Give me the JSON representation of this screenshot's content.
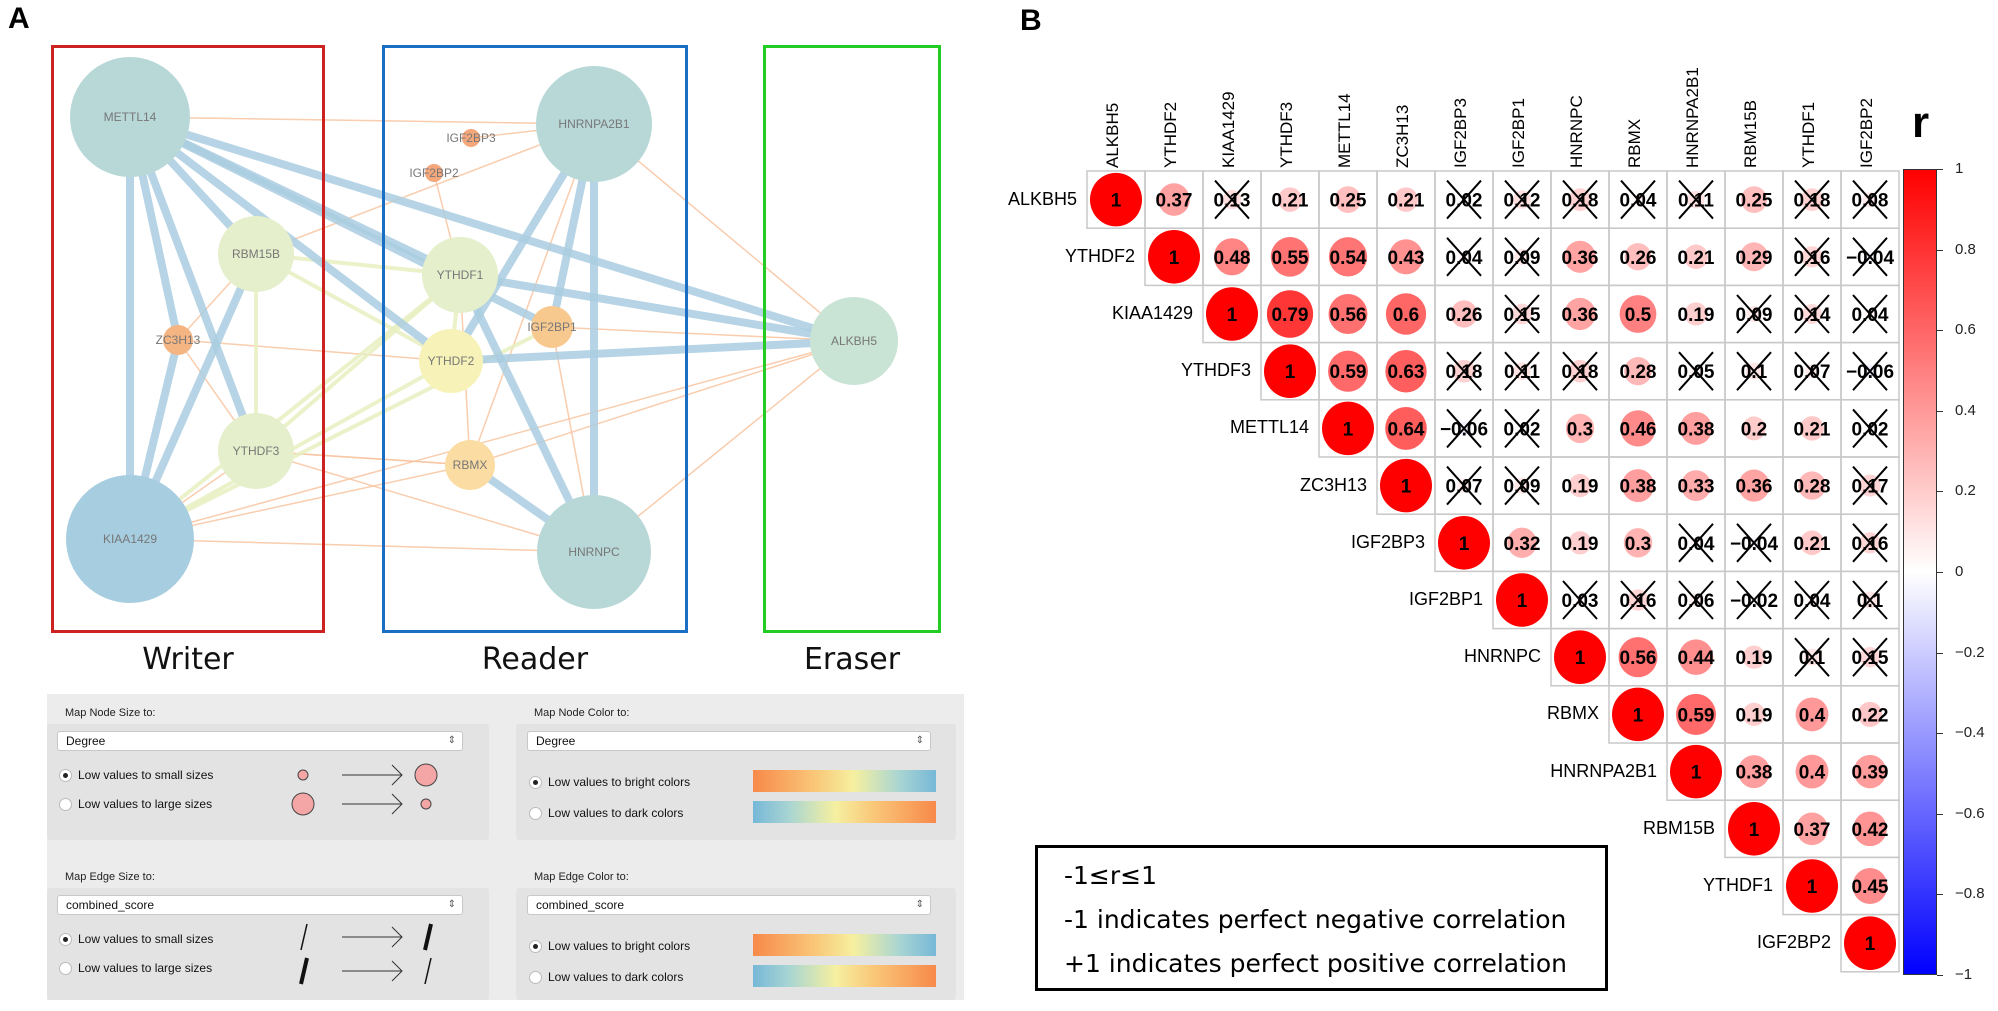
{
  "panel_a": {
    "letter": "A",
    "groups": [
      {
        "label": "Writer",
        "color": "#cc2222"
      },
      {
        "label": "Reader",
        "color": "#1a6fc4"
      },
      {
        "label": "Eraser",
        "color": "#22cc22"
      }
    ],
    "nodes": [
      {
        "name": "METTL14",
        "group": "Writer",
        "color": "#b8d8d8"
      },
      {
        "name": "RBM15B",
        "group": "Writer",
        "color": "#e6efcc"
      },
      {
        "name": "ZC3H13",
        "group": "Writer",
        "color": "#f5b583"
      },
      {
        "name": "YTHDF3",
        "group": "Writer",
        "color": "#e6efcc"
      },
      {
        "name": "KIAA1429",
        "group": "Writer",
        "color": "#a7cde0"
      },
      {
        "name": "HNRNPA2B1",
        "group": "Reader",
        "color": "#b8d8d8"
      },
      {
        "name": "IGF2BP3",
        "group": "Reader",
        "color": "#f3a77b"
      },
      {
        "name": "IGF2BP2",
        "group": "Reader",
        "color": "#f3a77b"
      },
      {
        "name": "YTHDF1",
        "group": "Reader",
        "color": "#e6efcc"
      },
      {
        "name": "IGF2BP1",
        "group": "Reader",
        "color": "#f8c98f"
      },
      {
        "name": "YTHDF2",
        "group": "Reader",
        "color": "#f7f3b8"
      },
      {
        "name": "RBMX",
        "group": "Reader",
        "color": "#fbdca3"
      },
      {
        "name": "HNRNPC",
        "group": "Reader",
        "color": "#b8d8d8"
      },
      {
        "name": "ALKBH5",
        "group": "Eraser",
        "color": "#c9e3d4"
      }
    ],
    "edges": [
      [
        "METTL14",
        "KIAA1429",
        "high"
      ],
      [
        "METTL14",
        "RBM15B",
        "high"
      ],
      [
        "METTL14",
        "ZC3H13",
        "high"
      ],
      [
        "METTL14",
        "YTHDF3",
        "high"
      ],
      [
        "KIAA1429",
        "RBM15B",
        "high"
      ],
      [
        "KIAA1429",
        "ZC3H13",
        "high"
      ],
      [
        "METTL14",
        "YTHDF1",
        "high"
      ],
      [
        "METTL14",
        "YTHDF2",
        "high"
      ],
      [
        "METTL14",
        "ALKBH5",
        "high"
      ],
      [
        "HNRNPA2B1",
        "HNRNPC",
        "high"
      ],
      [
        "HNRNPA2B1",
        "YTHDF2",
        "high"
      ],
      [
        "HNRNPA2B1",
        "IGF2BP1",
        "high"
      ],
      [
        "HNRNPC",
        "YTHDF1",
        "high"
      ],
      [
        "HNRNPC",
        "RBMX",
        "high"
      ],
      [
        "YTHDF2",
        "ALKBH5",
        "high"
      ],
      [
        "YTHDF1",
        "ALKBH5",
        "high"
      ],
      [
        "METTL14",
        "IGF2BP1",
        "high"
      ],
      [
        "RBM15B",
        "YTHDF3",
        "mid"
      ],
      [
        "YTHDF3",
        "YTHDF1",
        "mid"
      ],
      [
        "RBM15B",
        "YTHDF1",
        "mid"
      ],
      [
        "KIAA1429",
        "YTHDF2",
        "mid"
      ],
      [
        "YTHDF2",
        "YTHDF1",
        "mid"
      ],
      [
        "KIAA1429",
        "YTHDF1",
        "mid"
      ],
      [
        "KIAA1429",
        "IGF2BP1",
        "mid"
      ],
      [
        "RBM15B",
        "YTHDF2",
        "mid"
      ],
      [
        "METTL14",
        "HNRNPA2B1",
        "low"
      ],
      [
        "KIAA1429",
        "HNRNPC",
        "low"
      ],
      [
        "KIAA1429",
        "RBMX",
        "low"
      ],
      [
        "ZC3H13",
        "YTHDF3",
        "low"
      ],
      [
        "RBM15B",
        "ZC3H13",
        "low"
      ],
      [
        "HNRNPA2B1",
        "ALKBH5",
        "low"
      ],
      [
        "HNRNPC",
        "ALKBH5",
        "low"
      ],
      [
        "IGF2BP3",
        "HNRNPA2B1",
        "low"
      ],
      [
        "IGF2BP2",
        "YTHDF1",
        "low"
      ],
      [
        "RBMX",
        "YTHDF1",
        "low"
      ],
      [
        "RBMX",
        "HNRNPA2B1",
        "low"
      ],
      [
        "RBMX",
        "YTHDF3",
        "low"
      ],
      [
        "KIAA1429",
        "ALKBH5",
        "low"
      ],
      [
        "YTHDF3",
        "HNRNPC",
        "low"
      ],
      [
        "RBM15B",
        "HNRNPA2B1",
        "low"
      ],
      [
        "IGF2BP1",
        "HNRNPC",
        "low"
      ],
      [
        "IGF2BP1",
        "ALKBH5",
        "low"
      ],
      [
        "RBMX",
        "ALKBH5",
        "low"
      ],
      [
        "YTHDF3",
        "RBMX",
        "low"
      ],
      [
        "ZC3H13",
        "YTHDF2",
        "low"
      ],
      [
        "KIAA1429",
        "YTHDF3",
        "low"
      ]
    ],
    "edge_colors": {
      "high": "#a9cde0",
      "mid": "#e8efc0",
      "low": "#f8c4a0"
    },
    "settings": {
      "node_size": {
        "label": "Map Node Size to:",
        "value": "Degree",
        "options": [
          "Low values to small sizes",
          "Low values to large sizes"
        ],
        "selected": 0
      },
      "node_color": {
        "label": "Map Node Color to:",
        "value": "Degree",
        "options": [
          "Low values to bright colors",
          "Low values to dark colors"
        ],
        "selected": 0
      },
      "edge_size": {
        "label": "Map Edge Size to:",
        "value": "combined_score",
        "options": [
          "Low values to small sizes",
          "Low values to large sizes"
        ],
        "selected": 0
      },
      "edge_color": {
        "label": "Map Edge Color to:",
        "value": "combined_score",
        "options": [
          "Low values to bright colors",
          "Low values to dark colors"
        ],
        "selected": 0
      }
    }
  },
  "panel_b": {
    "letter": "B",
    "legend_lines": [
      "-1≤r≤1",
      "-1  indicates perfect negative correlation",
      "+1 indicates perfect positive correlation"
    ]
  },
  "chart_data": {
    "type": "heatmap",
    "style": "corrplot upper triangle, circle size and color by r; insignificant values crossed out",
    "variables": [
      "ALKBH5",
      "YTHDF2",
      "KIAA1429",
      "YTHDF3",
      "METTL14",
      "ZC3H13",
      "IGF2BP3",
      "IGF2BP1",
      "HNRNPC",
      "RBMX",
      "HNRNPA2B1",
      "RBM15B",
      "YTHDF1",
      "IGF2BP2"
    ],
    "upper_triangle_rows": [
      [
        1,
        0.37,
        0.13,
        0.21,
        0.25,
        0.21,
        0.02,
        0.12,
        0.18,
        0.04,
        0.11,
        0.25,
        0.18,
        0.08
      ],
      [
        1,
        0.48,
        0.55,
        0.54,
        0.43,
        0.04,
        0.09,
        0.36,
        0.26,
        0.21,
        0.29,
        0.16,
        -0.04
      ],
      [
        1,
        0.79,
        0.56,
        0.6,
        0.26,
        0.15,
        0.36,
        0.5,
        0.19,
        0.09,
        0.14,
        0.04
      ],
      [
        1,
        0.59,
        0.63,
        0.18,
        0.11,
        0.18,
        0.28,
        0.05,
        0.1,
        0.07,
        -0.06
      ],
      [
        1,
        0.64,
        -0.06,
        0.02,
        0.3,
        0.46,
        0.38,
        0.2,
        0.21,
        0.02
      ],
      [
        1,
        0.07,
        0.09,
        0.19,
        0.38,
        0.33,
        0.36,
        0.28,
        0.17
      ],
      [
        1,
        0.32,
        0.19,
        0.3,
        0.04,
        -0.04,
        0.21,
        0.16
      ],
      [
        1,
        0.03,
        0.16,
        0.06,
        -0.02,
        0.04,
        0.1
      ],
      [
        1,
        0.56,
        0.44,
        0.19,
        0.1,
        0.15
      ],
      [
        1,
        0.59,
        0.19,
        0.4,
        0.22
      ],
      [
        1,
        0.38,
        0.4,
        0.39
      ],
      [
        1,
        0.37,
        0.42
      ],
      [
        1,
        0.45
      ],
      [
        1
      ]
    ],
    "crossed_out": [
      [
        0,
        0,
        1,
        0,
        0,
        0,
        1,
        1,
        1,
        1,
        1,
        0,
        1,
        1
      ],
      [
        0,
        0,
        0,
        0,
        0,
        1,
        1,
        0,
        0,
        0,
        0,
        1,
        1
      ],
      [
        0,
        0,
        0,
        0,
        0,
        1,
        0,
        0,
        0,
        1,
        1,
        1
      ],
      [
        0,
        0,
        0,
        1,
        1,
        1,
        0,
        1,
        1,
        1,
        1
      ],
      [
        0,
        0,
        1,
        1,
        0,
        0,
        0,
        0,
        0,
        1
      ],
      [
        0,
        1,
        1,
        0,
        0,
        0,
        0,
        0,
        1
      ],
      [
        0,
        0,
        0,
        0,
        1,
        1,
        0,
        1
      ],
      [
        0,
        1,
        1,
        1,
        1,
        1,
        1
      ],
      [
        0,
        0,
        0,
        0,
        1,
        1
      ],
      [
        0,
        0,
        0,
        0,
        0
      ],
      [
        0,
        0,
        0,
        0
      ],
      [
        0,
        0,
        0
      ],
      [
        0,
        0
      ],
      [
        0
      ]
    ],
    "colorbar": {
      "title": "r",
      "range": [
        -1,
        1
      ],
      "ticks": [
        "1",
        "0.8",
        "0.6",
        "0.4",
        "0.2",
        "0",
        "−0.2",
        "−0.4",
        "−0.6",
        "−0.8",
        "−1"
      ],
      "colors": {
        "positive": "#ff0000",
        "zero": "#ffffff",
        "negative": "#0000ff"
      }
    }
  }
}
